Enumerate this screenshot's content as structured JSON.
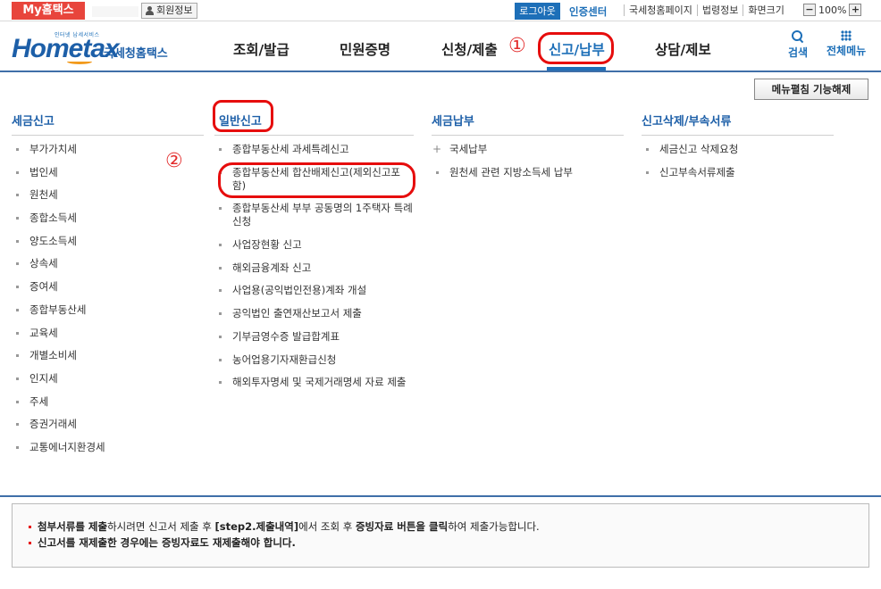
{
  "topbar": {
    "my_home": "My홈택스",
    "member_info": "회원정보",
    "logout": "로그아웃",
    "cert_center": "인증센터",
    "links": [
      "국세청홈페이지",
      "법령정보",
      "화면크기"
    ],
    "zoom_minus": "−",
    "zoom_value": "100%",
    "zoom_plus": "+"
  },
  "logo": {
    "small_text": "인터넷 납세서비스",
    "main_text": "Hometax",
    "kr_text": "국세청홈택스"
  },
  "nav": {
    "items": [
      "조회/발급",
      "민원증명",
      "신청/제출",
      "신고/납부",
      "상담/제보"
    ],
    "active_index": 3,
    "search_label": "검색",
    "all_menu_label": "전체메뉴"
  },
  "annotations": {
    "one": "①",
    "two": "②"
  },
  "menu_fold_button": "메뉴펼침 기능해제",
  "columns": [
    {
      "title": "세금신고",
      "items": [
        "부가가치세",
        "법인세",
        "원천세",
        "종합소득세",
        "양도소득세",
        "상속세",
        "증여세",
        "종합부동산세",
        "교육세",
        "개별소비세",
        "인지세",
        "주세",
        "증권거래세",
        "교통에너지환경세"
      ]
    },
    {
      "title": "일반신고",
      "items": [
        "종합부동산세 과세특례신고",
        "종합부동산세 합산배제신고(제외신고포함)",
        "종합부동산세 부부 공동명의 1주택자 특례 신청",
        "사업장현황 신고",
        "해외금융계좌 신고",
        "사업용(공익법인전용)계좌 개설",
        "공익법인 출연재산보고서 제출",
        "기부금영수증 발급합계표",
        "농어업용기자재환급신청",
        "해외투자명세 및 국제거래명세 자료 제출"
      ]
    },
    {
      "title": "세금납부",
      "items": [
        "국세납부",
        "원천세 관련 지방소득세 납부"
      ]
    },
    {
      "title": "신고삭제/부속서류",
      "items": [
        "세금신고 삭제요청",
        "신고부속서류제출"
      ]
    }
  ],
  "notice": {
    "line1_bold1": "첨부서류를 제출",
    "line1_text1": "하시려면 신고서 제출 후 ",
    "line1_bold2": "[step2.제출내역]",
    "line1_text2": "에서 조회 후 ",
    "line1_bold3": "증빙자료 버튼을 클릭",
    "line1_text3": "하여 제출가능합니다.",
    "line2": "신고서를 재제출한 경우에는 증빙자료도 재제출해야 합니다."
  },
  "colors": {
    "brand_blue": "#1d6fb8",
    "my_home_red": "#e8453c",
    "annotation_red": "#e60d0d"
  }
}
